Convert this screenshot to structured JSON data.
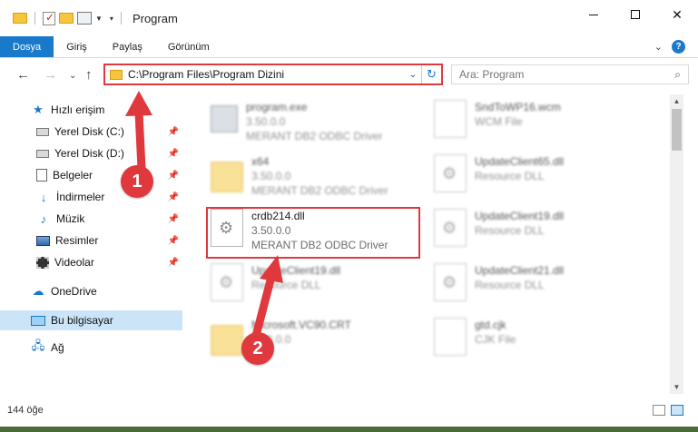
{
  "window": {
    "title": "Program",
    "controls": {
      "minimize": "—",
      "maximize": "☐",
      "close": "✕"
    }
  },
  "ribbon": {
    "tabs": [
      "Dosya",
      "Giriş",
      "Paylaş",
      "Görünüm"
    ],
    "active_tab": "Dosya",
    "accent": "#1979ca"
  },
  "address": {
    "path": "C:\\Program Files\\Program Dizini",
    "search_placeholder": "Ara: Program"
  },
  "navigation": {
    "items": [
      {
        "label": "Hızlı erişim",
        "icon": "star-icon",
        "pinned": false
      },
      {
        "label": "Yerel Disk (C:)",
        "icon": "disk-icon",
        "pinned": true
      },
      {
        "label": "Yerel Disk (D:)",
        "icon": "disk-icon",
        "pinned": true
      },
      {
        "label": "Belgeler",
        "icon": "documents-icon",
        "pinned": true
      },
      {
        "label": "İndirmeler",
        "icon": "download-icon",
        "pinned": true
      },
      {
        "label": "Müzik",
        "icon": "music-icon",
        "pinned": true
      },
      {
        "label": "Resimler",
        "icon": "pictures-icon",
        "pinned": true
      },
      {
        "label": "Videolar",
        "icon": "videos-icon",
        "pinned": true
      },
      {
        "label": "OneDrive",
        "icon": "cloud-icon",
        "pinned": false
      },
      {
        "label": "Bu bilgisayar",
        "icon": "computer-icon",
        "pinned": false,
        "selected": true
      },
      {
        "label": "Ağ",
        "icon": "network-icon",
        "pinned": false
      }
    ]
  },
  "files": [
    {
      "name": "program.exe",
      "line2": "3.50.0.0",
      "line3": "MERANT DB2 ODBC Driver",
      "type": "exe",
      "blurred": true
    },
    {
      "name": "SndToWP16.wcm",
      "line2": "WCM File",
      "line3": "",
      "type": "blank",
      "blurred": true
    },
    {
      "name": "x64",
      "line2": "3.50.0.0",
      "line3": "MERANT DB2 ODBC Driver",
      "type": "folder",
      "blurred": true
    },
    {
      "name": "UpdateClient65.dll",
      "line2": "Resource DLL",
      "line3": "",
      "type": "dll",
      "blurred": true
    },
    {
      "name": "crdb214.dll",
      "line2": "3.50.0.0",
      "line3": "MERANT DB2 ODBC Driver",
      "type": "dll",
      "blurred": false
    },
    {
      "name": "UpdateClient19.dll",
      "line2": "Resource DLL",
      "line3": "",
      "type": "dll",
      "blurred": true
    },
    {
      "name": "UpdateClient19.dll",
      "line2": "Resource DLL",
      "line3": "",
      "type": "dll",
      "blurred": true
    },
    {
      "name": "UpdateClient21.dll",
      "line2": "Resource DLL",
      "line3": "",
      "type": "dll",
      "blurred": true
    },
    {
      "name": "Microsoft.VC90.CRT",
      "line2": "3.50.0.0",
      "line3": "",
      "type": "folder",
      "blurred": true
    },
    {
      "name": "gtd.cjk",
      "line2": "CJK File",
      "line3": "",
      "type": "blank",
      "blurred": true
    }
  ],
  "status": {
    "item_count": "144 öğe"
  },
  "annotations": {
    "step1": "1",
    "step2": "2",
    "color": "#e0393d"
  }
}
